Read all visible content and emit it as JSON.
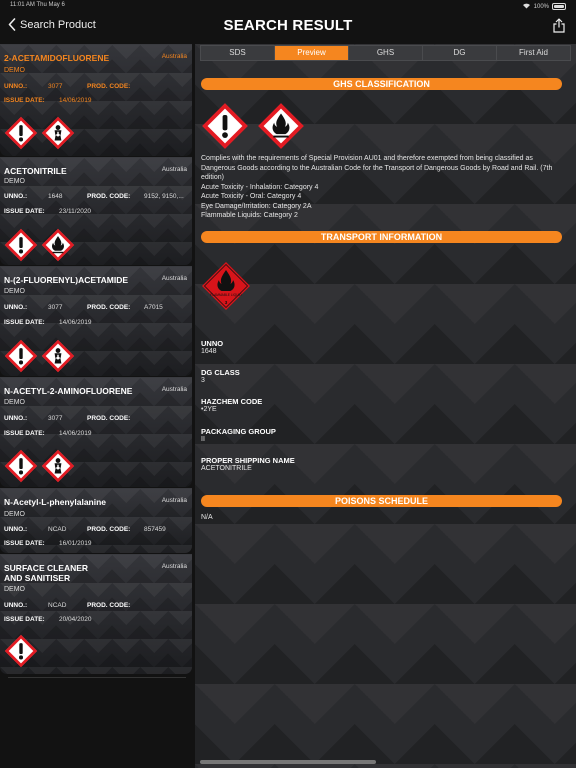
{
  "status_bar": {
    "time": "11:01 AM   Thu May 6",
    "battery": "100%"
  },
  "nav": {
    "back_label": "Search Product",
    "title": "SEARCH RESULT"
  },
  "labels": {
    "unno": "UNNO.:",
    "prod_code": "PROD. CODE:",
    "issue_date": "ISSUE DATE:"
  },
  "products": [
    {
      "name": "2-ACETAMIDOFLUORENE",
      "country": "Australia",
      "company": "DEMO",
      "unno": "3077",
      "prod_code": "",
      "issue_date": "14/06/2019",
      "pictograms": [
        "exclamation-pictogram",
        "health-hazard-pictogram"
      ]
    },
    {
      "name": "ACETONITRILE",
      "country": "Australia",
      "company": "DEMO",
      "unno": "1648",
      "prod_code": "9152, 9150,...",
      "issue_date": "23/11/2020",
      "pictograms": [
        "exclamation-pictogram",
        "flame-pictogram"
      ]
    },
    {
      "name": "N-(2-FLUORENYL)ACETAMIDE",
      "country": "Australia",
      "company": "DEMO",
      "unno": "3077",
      "prod_code": "A7015",
      "issue_date": "14/06/2019",
      "pictograms": [
        "exclamation-pictogram",
        "health-hazard-pictogram"
      ]
    },
    {
      "name": "N-ACETYL-2-AMINOFLUORENE",
      "country": "Australia",
      "company": "DEMO",
      "unno": "3077",
      "prod_code": "",
      "issue_date": "14/06/2019",
      "pictograms": [
        "exclamation-pictogram",
        "health-hazard-pictogram"
      ]
    },
    {
      "name": "N-Acetyl-L-phenylalanine",
      "country": "Australia",
      "company": "DEMO",
      "unno": "NCAD",
      "prod_code": "857459",
      "issue_date": "16/01/2019",
      "pictograms": []
    },
    {
      "name": "SURFACE CLEANER\nAND SANITISER",
      "country": "Australia",
      "company": "DEMO",
      "unno": "NCAD",
      "prod_code": "",
      "issue_date": "20/04/2020",
      "pictograms": [
        "exclamation-pictogram"
      ]
    }
  ],
  "tabs": [
    "SDS",
    "Preview",
    "GHS",
    "DG",
    "First Aid"
  ],
  "active_tab": "Preview",
  "detail": {
    "ghs_title": "GHS CLASSIFICATION",
    "ghs_pictograms": [
      "exclamation-pictogram",
      "flame-pictogram"
    ],
    "ghs_lines": [
      "Complies with the requirements of Special Provision AU01 and therefore exempted from being classified as Dangerous Goods according to the Australian Code for the Transport of Dangerous Goods by Road and Rail. (7th edition)",
      "Acute Toxicity - Inhalation: Category 4",
      "Acute Toxicity - Oral: Category 4",
      "Eye Damage/Irritation: Category 2A",
      "Flammable Liquids: Category 2"
    ],
    "transport_title": "TRANSPORT INFORMATION",
    "transport_diamond_text": "FLAMMABLE LIQUID",
    "transport_diamond_number": "3",
    "unno_label": "UNNO",
    "unno_value": "1648",
    "dg_class_label": "DG CLASS",
    "dg_class_value": "3",
    "hazchem_label": "HAZCHEM CODE",
    "hazchem_value": "•2YE",
    "packaging_label": "PACKAGING GROUP",
    "packaging_value": "II",
    "shipping_label": "PROPER SHIPPING NAME",
    "shipping_value": "ACETONITRILE",
    "poisons_title": "POISONS SCHEDULE",
    "poisons_value": "N/A"
  },
  "colors": {
    "accent": "#f5861f",
    "hazard_red": "#e31b23",
    "dg_red": "#d7141a"
  }
}
